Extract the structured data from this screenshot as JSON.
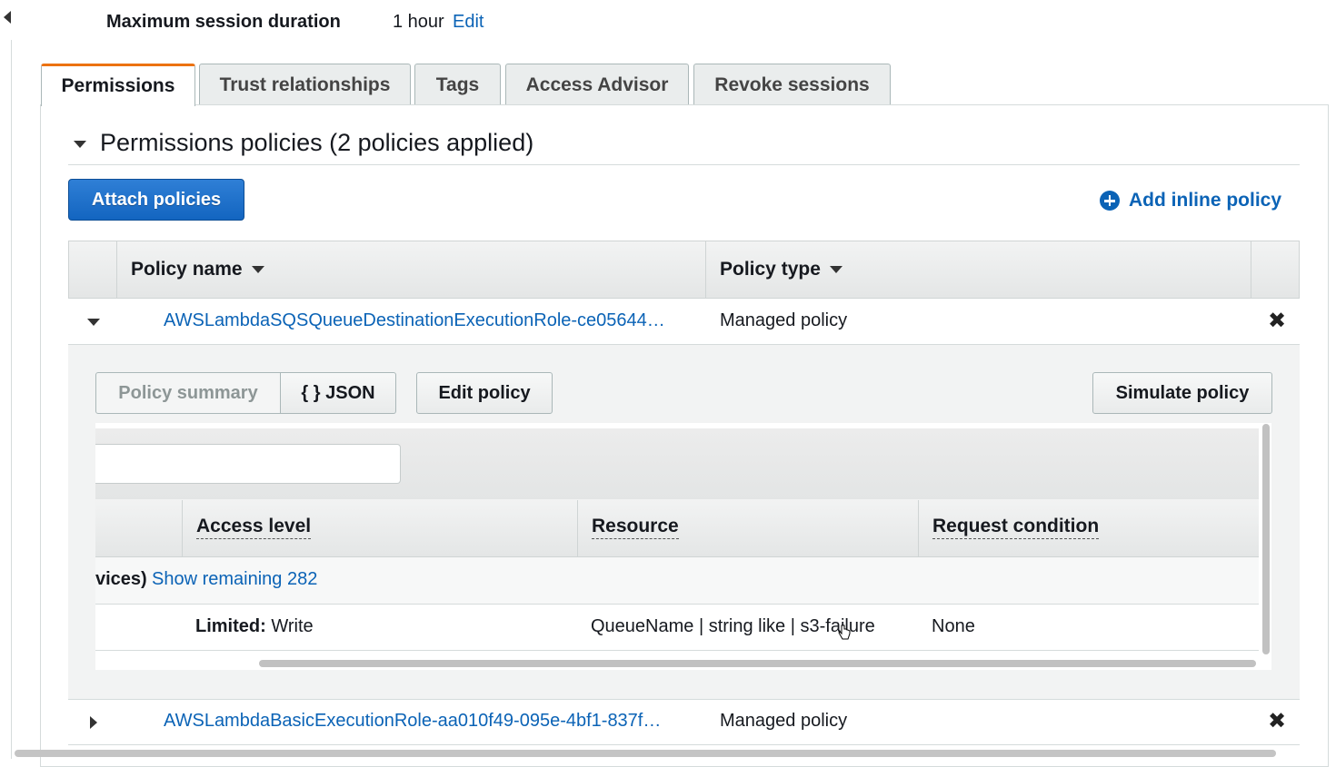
{
  "session": {
    "label": "Maximum session duration",
    "value": "1 hour",
    "edit_label": "Edit"
  },
  "tabs": [
    {
      "label": "Permissions",
      "active": true
    },
    {
      "label": "Trust relationships",
      "active": false
    },
    {
      "label": "Tags",
      "active": false
    },
    {
      "label": "Access Advisor",
      "active": false
    },
    {
      "label": "Revoke sessions",
      "active": false
    }
  ],
  "permissions": {
    "title": "Permissions policies (2 policies applied)",
    "attach_button": "Attach policies",
    "add_inline": "Add inline policy",
    "columns": {
      "policy_name": "Policy name",
      "policy_type": "Policy type"
    },
    "policies": [
      {
        "name": "AWSLambdaSQSQueueDestinationExecutionRole-ce05644…",
        "type": "Managed policy",
        "expanded": true,
        "remove": "✖"
      },
      {
        "name": "AWSLambdaBasicExecutionRole-aa010f49-095e-4bf1-837f…",
        "type": "Managed policy",
        "expanded": false,
        "remove": "✖"
      }
    ]
  },
  "detail": {
    "policy_summary": "Policy summary",
    "json": "{ } JSON",
    "edit_policy": "Edit policy",
    "simulate_policy": "Simulate policy",
    "filter_placeholder": "",
    "columns": {
      "access_level": "Access level",
      "resource": "Resource",
      "request_condition": "Request condition"
    },
    "services_text": "vices)",
    "show_remaining": "Show remaining 282",
    "row": {
      "access_level_bold": "Limited:",
      "access_level_rest": " Write",
      "resource": "QueueName | string like | s3-failure",
      "request_condition": "None"
    }
  },
  "colors": {
    "link": "#0b63b6",
    "primary_button": "#1365c0",
    "active_tab_accent": "#ec7211"
  }
}
